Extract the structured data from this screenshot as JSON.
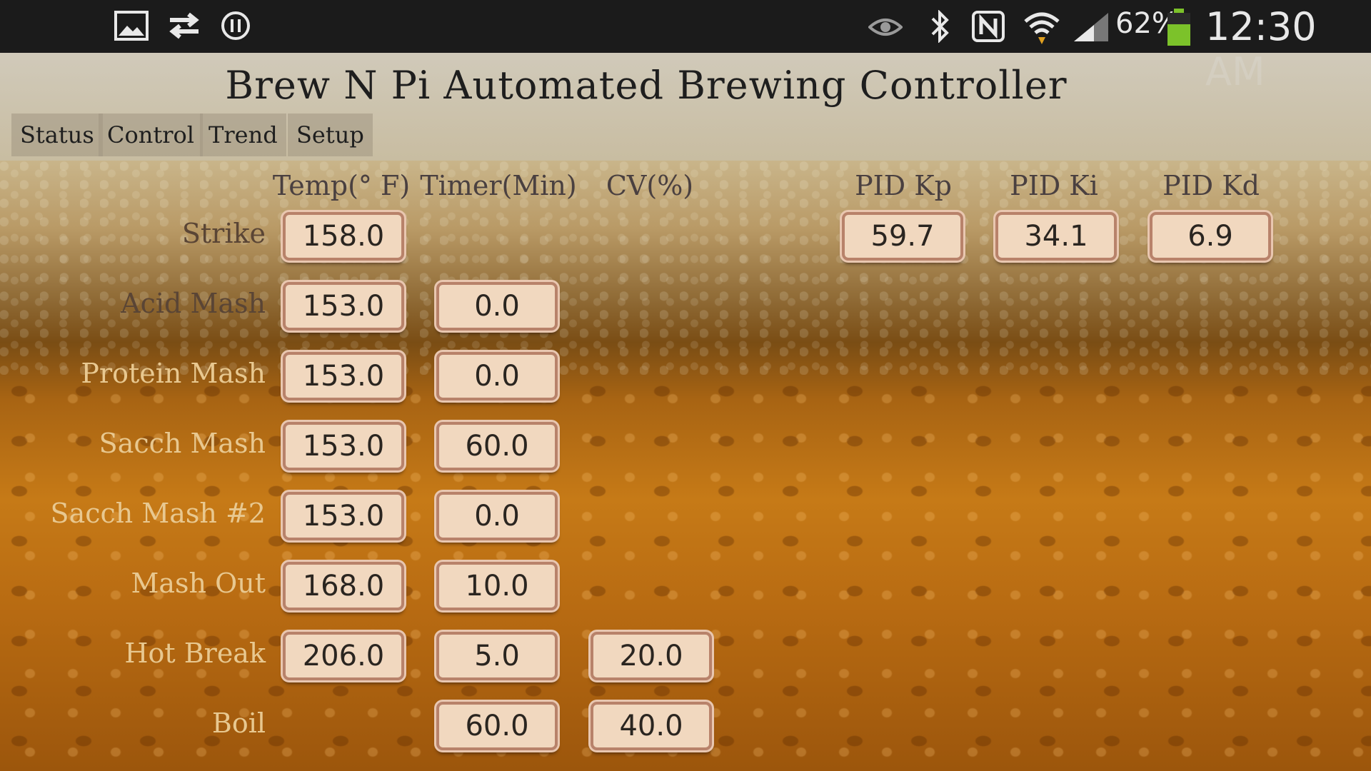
{
  "status_bar": {
    "battery_percent": "62%",
    "time": "12:30 AM",
    "left_icons": [
      "gallery-icon",
      "sync-icon",
      "pause-icon"
    ],
    "right_icons": [
      "eye-icon",
      "bluetooth-icon",
      "nfc-icon",
      "wifi-icon",
      "signal-icon",
      "battery-icon"
    ]
  },
  "header": {
    "title": "Brew N Pi Automated Brewing Controller",
    "tabs": [
      "Status",
      "Control",
      "Trend",
      "Setup"
    ]
  },
  "columns": {
    "temp": "Temp(° F)",
    "timer": "Timer(Min)",
    "cv": "CV(%)",
    "pid_kp": "PID Kp",
    "pid_ki": "PID Ki",
    "pid_kd": "PID Kd"
  },
  "pid": {
    "kp": "59.7",
    "ki": "34.1",
    "kd": "6.9"
  },
  "rows": [
    {
      "label": "Strike",
      "temp": "158.0"
    },
    {
      "label": "Acid Mash",
      "temp": "153.0",
      "timer": "0.0"
    },
    {
      "label": "Protein Mash",
      "temp": "153.0",
      "timer": "0.0"
    },
    {
      "label": "Sacch Mash",
      "temp": "153.0",
      "timer": "60.0"
    },
    {
      "label": "Sacch Mash #2",
      "temp": "153.0",
      "timer": "0.0"
    },
    {
      "label": "Mash Out",
      "temp": "168.0",
      "timer": "10.0"
    },
    {
      "label": "Hot Break",
      "temp": "206.0",
      "timer": "5.0",
      "cv": "20.0"
    },
    {
      "label": "Boil",
      "timer": "60.0",
      "cv": "40.0"
    }
  ],
  "colors": {
    "field_bg": "#f1d8bf",
    "field_border": "#b8826a",
    "status_bar": "#1b1b1b"
  }
}
